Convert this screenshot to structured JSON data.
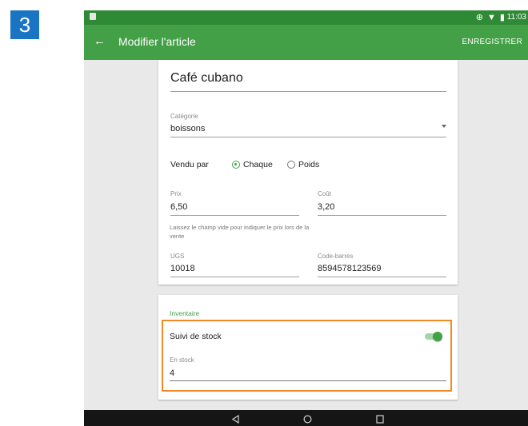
{
  "step_number": "3",
  "status_bar": {
    "time": "11:03",
    "icons": "⊕ ▼ ▮"
  },
  "app_bar": {
    "title": "Modifier l'article",
    "save_label": "ENREGISTRER"
  },
  "item_form": {
    "name_value": "Café cubano",
    "category_label": "Catégorie",
    "category_value": "boissons",
    "sold_by_label": "Vendu par",
    "sold_by_options": [
      "Chaque",
      "Poids"
    ],
    "sold_by_selected": "Chaque",
    "price_label": "Prix",
    "price_value": "6,50",
    "cost_label": "Coût",
    "cost_value": "3,20",
    "price_hint": "Laissez le champ vide pour indiquer le prix lors de la vente",
    "sku_label": "UGS",
    "sku_value": "10018",
    "barcode_label": "Code-barres",
    "barcode_value": "8594578123569"
  },
  "inventory": {
    "section_title": "Inventaire",
    "track_stock_label": "Suivi de stock",
    "track_stock_enabled": true,
    "in_stock_label": "En stock",
    "in_stock_value": "4"
  },
  "colors": {
    "primary": "#43a047",
    "status_bar": "#2f8a36",
    "highlight": "#f08a24",
    "step_badge": "#1a74c4"
  }
}
